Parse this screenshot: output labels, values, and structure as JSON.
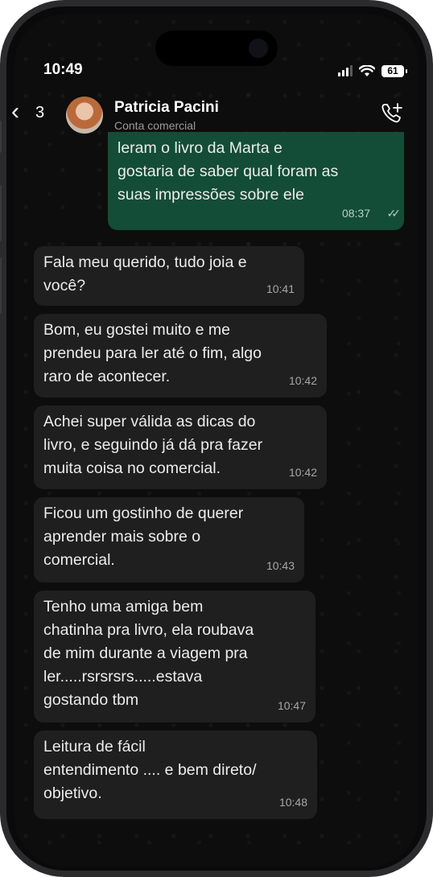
{
  "status_bar": {
    "time": "10:49",
    "battery": "61"
  },
  "header": {
    "back_count": "3",
    "contact_name": "Patricia Pacini",
    "contact_subtitle": "Conta comercial"
  },
  "messages": [
    {
      "direction": "outgoing",
      "text": "leram o livro da Marta e\ngostaria de saber qual foram as\nsuas impressões sobre ele",
      "time": "08:37",
      "status": "read"
    },
    {
      "direction": "incoming",
      "text": "Fala meu querido, tudo joia e\nvocê?",
      "time": "10:41"
    },
    {
      "direction": "incoming",
      "text": "Bom, eu gostei muito e me\nprendeu para ler até o fim, algo\nraro de acontecer.",
      "time": "10:42"
    },
    {
      "direction": "incoming",
      "text": "Achei super válida as dicas do\nlivro, e seguindo já dá pra fazer\nmuita coisa no comercial.",
      "time": "10:42"
    },
    {
      "direction": "incoming",
      "text": "Ficou um gostinho de querer\naprender mais sobre o\ncomercial.",
      "time": "10:43"
    },
    {
      "direction": "incoming",
      "text": "Tenho uma amiga bem\nchatinha pra livro, ela roubava\nde mim durante a viagem pra\nler.....rsrsrsrs.....estava\ngostando tbm",
      "time": "10:47"
    },
    {
      "direction": "incoming",
      "text": "Leitura de fácil\nentendimento .... e bem direto/\nobjetivo.",
      "time": "10:48"
    }
  ],
  "colors": {
    "incoming_bubble": "#1f1f1f",
    "outgoing_bubble": "#134d37",
    "background": "#0d0d0d"
  },
  "icons": [
    "back-chevron-icon",
    "call-add-icon",
    "signal-icon",
    "wifi-icon",
    "battery-icon",
    "read-ticks-icon"
  ]
}
